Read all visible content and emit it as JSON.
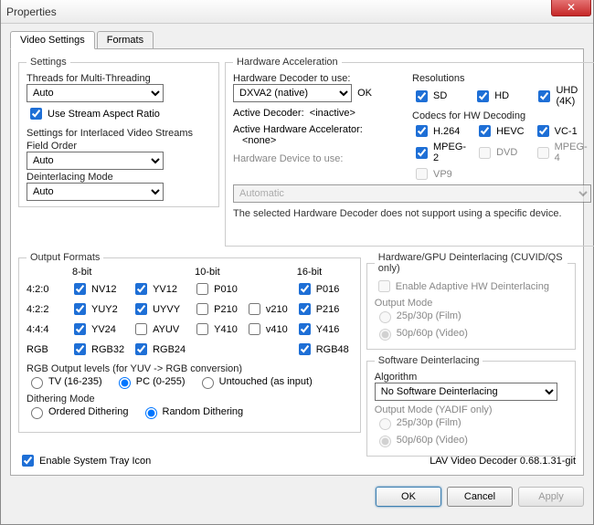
{
  "window": {
    "title": "Properties"
  },
  "tabs": {
    "video": "Video Settings",
    "formats": "Formats"
  },
  "settings": {
    "legend": "Settings",
    "threads_label": "Threads for Multi-Threading",
    "threads_value": "Auto",
    "use_stream_ar": "Use Stream Aspect Ratio",
    "interlaced_label": "Settings for Interlaced Video Streams",
    "field_order_label": "Field Order",
    "field_order_value": "Auto",
    "deint_mode_label": "Deinterlacing Mode",
    "deint_mode_value": "Auto"
  },
  "hw": {
    "legend": "Hardware Acceleration",
    "decoder_label": "Hardware Decoder to use:",
    "decoder_value": "DXVA2 (native)",
    "ok": "OK",
    "active_decoder_label": "Active Decoder:",
    "active_decoder_value": "<inactive>",
    "active_accel_label": "Active Hardware Accelerator:",
    "active_accel_value": "<none>",
    "device_label": "Hardware Device to use:",
    "device_value": "Automatic",
    "note": "The selected Hardware Decoder does not support using a specific device.",
    "res_label": "Resolutions",
    "res": {
      "sd": "SD",
      "hd": "HD",
      "uhd": "UHD (4K)"
    },
    "codecs_label": "Codecs for HW Decoding",
    "codecs": {
      "h264": "H.264",
      "hevc": "HEVC",
      "vc1": "VC-1",
      "mpeg2": "MPEG-2",
      "dvd": "DVD",
      "mpeg4": "MPEG-4",
      "vp9": "VP9"
    }
  },
  "outfmt": {
    "legend": "Output Formats",
    "hdr8": "8-bit",
    "hdr10": "10-bit",
    "hdr16": "16-bit",
    "r420": "4:2:0",
    "r422": "4:2:2",
    "r444": "4:4:4",
    "rrgb": "RGB",
    "nv12": "NV12",
    "yv12": "YV12",
    "p010": "P010",
    "p016": "P016",
    "yuy2": "YUY2",
    "uyvy": "UYVY",
    "p210": "P210",
    "v210": "v210",
    "p216": "P216",
    "yv24": "YV24",
    "ayuv": "AYUV",
    "y410": "Y410",
    "v410": "v410",
    "y416": "Y416",
    "rgb32": "RGB32",
    "rgb24": "RGB24",
    "rgb48": "RGB48",
    "rgblevels_label": "RGB Output levels (for YUV -> RGB conversion)",
    "tv": "TV (16-235)",
    "pc": "PC (0-255)",
    "untouched": "Untouched (as input)",
    "dither_label": "Dithering Mode",
    "ordered": "Ordered Dithering",
    "random": "Random Dithering"
  },
  "hwdeint": {
    "legend": "Hardware/GPU Deinterlacing (CUVID/QS only)",
    "enable": "Enable Adaptive HW Deinterlacing",
    "outmode": "Output Mode",
    "film": "25p/30p (Film)",
    "video": "50p/60p (Video)"
  },
  "swdeint": {
    "legend": "Software Deinterlacing",
    "algo_label": "Algorithm",
    "algo_value": "No Software Deinterlacing",
    "outmode": "Output Mode (YADIF only)",
    "film": "25p/30p (Film)",
    "video": "50p/60p (Video)"
  },
  "footer": {
    "tray": "Enable System Tray Icon",
    "version": "LAV Video Decoder 0.68.1.31-git",
    "ok": "OK",
    "cancel": "Cancel",
    "apply": "Apply"
  }
}
